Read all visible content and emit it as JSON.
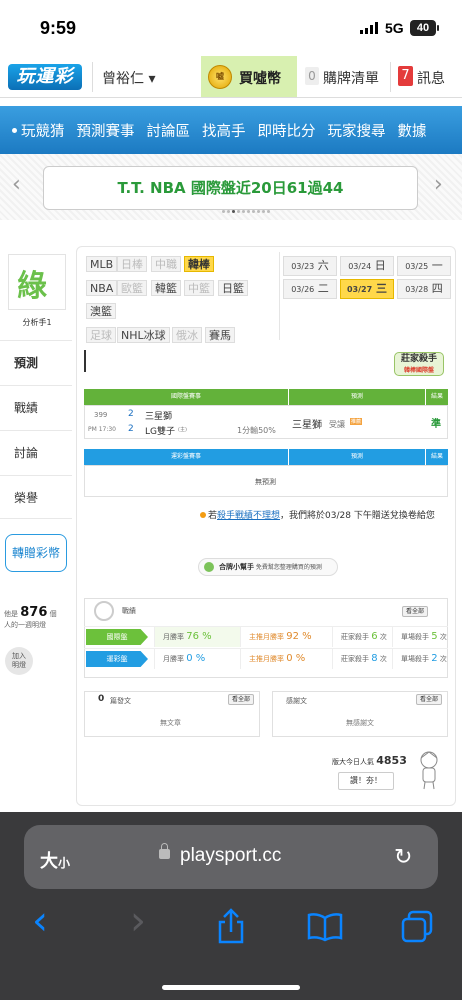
{
  "status": {
    "time": "9:59",
    "network": "5G",
    "battery": "40"
  },
  "header": {
    "logo": "玩運彩",
    "user": "曾裕仁 ▾",
    "coins_icon": "噓",
    "coins_label": "買噓幣",
    "cart_count": "0",
    "cart_label": "購牌清單",
    "msg_count": "7",
    "msg_label": "訊息"
  },
  "nav": [
    "玩競猜",
    "預測賽事",
    "討論區",
    "找高手",
    "即時比分",
    "玩家搜尋",
    "數據"
  ],
  "banner": {
    "text": "T.T. NBA 國際盤近20日61過44",
    "prev": "‹",
    "next": "›"
  },
  "sidebar": {
    "avatar_glyph": "綠",
    "analyst_label": "分析手1",
    "tabs": [
      "預測",
      "戰績",
      "討論",
      "榮譽"
    ],
    "transfer_label": "轉贈彩幣",
    "bonus_prefix": "他是",
    "bonus_count": "876",
    "bonus_suffix_1": "個",
    "bonus_suffix_2": "人的一週明燈",
    "follow_label_1": "加入",
    "follow_label_2": "明燈"
  },
  "sports": [
    {
      "label": "MLB",
      "state": "on"
    },
    {
      "label": "日棒",
      "state": "off"
    },
    {
      "label": "中職",
      "state": "off"
    },
    {
      "label": "韓棒",
      "state": "sel"
    },
    {
      "label": "NBA",
      "state": "on"
    },
    {
      "label": "歐籃",
      "state": "off"
    },
    {
      "label": "韓籃",
      "state": "on"
    },
    {
      "label": "中籃",
      "state": "off"
    },
    {
      "label": "日籃",
      "state": "on"
    },
    {
      "label": "澳籃",
      "state": "on"
    },
    {
      "label": "足球",
      "state": "off"
    },
    {
      "label": "NHL冰球",
      "state": "on"
    },
    {
      "label": "俄冰",
      "state": "off"
    },
    {
      "label": "賽馬",
      "state": "on"
    }
  ],
  "dates": [
    {
      "md": "03/23",
      "wd": "六",
      "sel": false
    },
    {
      "md": "03/24",
      "wd": "日",
      "sel": false
    },
    {
      "md": "03/25",
      "wd": "一",
      "sel": false
    },
    {
      "md": "03/26",
      "wd": "二",
      "sel": false
    },
    {
      "md": "03/27",
      "wd": "三",
      "sel": true
    },
    {
      "md": "03/28",
      "wd": "四",
      "sel": false
    }
  ],
  "badge": {
    "title": "莊家殺手",
    "sub": "韓棒國際盤"
  },
  "intl_table": {
    "headers": [
      "國際盤賽事",
      "預測",
      "結果"
    ],
    "game_no": "399",
    "game_time": "PM 17:30",
    "home_num": "2",
    "home_team": "三星獅",
    "away_num": "2",
    "away_team": "LG雙子",
    "away_tag": "(主)",
    "line": "1分輸50%",
    "pick": "三星獅",
    "pick_note": "受讓",
    "pick_tag": "推薦",
    "result": "準"
  },
  "lottery_table": {
    "headers": [
      "運彩盤賽事",
      "預測",
      "結果"
    ],
    "empty": "無預測"
  },
  "notice": {
    "prefix": "若",
    "link": "殺手戰績不理想",
    "suffix": "，我們將於03/28 下午贈送兌換卷給您"
  },
  "helper": {
    "name": "合牌小幫手",
    "desc": "免費幫您整理購買的預測"
  },
  "record": {
    "title": "戰績",
    "view_all": "看全部",
    "rows": [
      {
        "tag": "國際盤",
        "color": "#6cc13b",
        "c1_label": "月勝率",
        "c1_val": "76 %",
        "c2_label": "主推月勝率",
        "c2_val": "92 %",
        "c3_label": "莊家殺手",
        "c3_val": "6",
        "c3_unit": "次",
        "c4_label": "單場殺手",
        "c4_val": "5",
        "c4_unit": "次"
      },
      {
        "tag": "運彩盤",
        "color": "#229de2",
        "c1_label": "月勝率",
        "c1_val": "0 %",
        "c2_label": "主推月勝率",
        "c2_val": "0 %",
        "c3_label": "莊家殺手",
        "c3_val": "8",
        "c3_unit": "次",
        "c4_label": "單場殺手",
        "c4_val": "2",
        "c4_unit": "次"
      }
    ]
  },
  "posts": {
    "count": "0",
    "label": "篇發文",
    "view_all": "看全部",
    "empty": "無文章"
  },
  "thanks": {
    "label": "感謝文",
    "view_all": "看全部",
    "empty": "無感謝文"
  },
  "popularity": {
    "label": "版大今日人氣",
    "value": "4853",
    "button": "讚！夯！"
  },
  "browser": {
    "aa_big": "大",
    "aa_small": "小",
    "host": "playsport.cc",
    "reload": "↻",
    "back": "‹",
    "forward": "›",
    "share": "⇪",
    "books": "📖",
    "tabs": "⧉"
  }
}
